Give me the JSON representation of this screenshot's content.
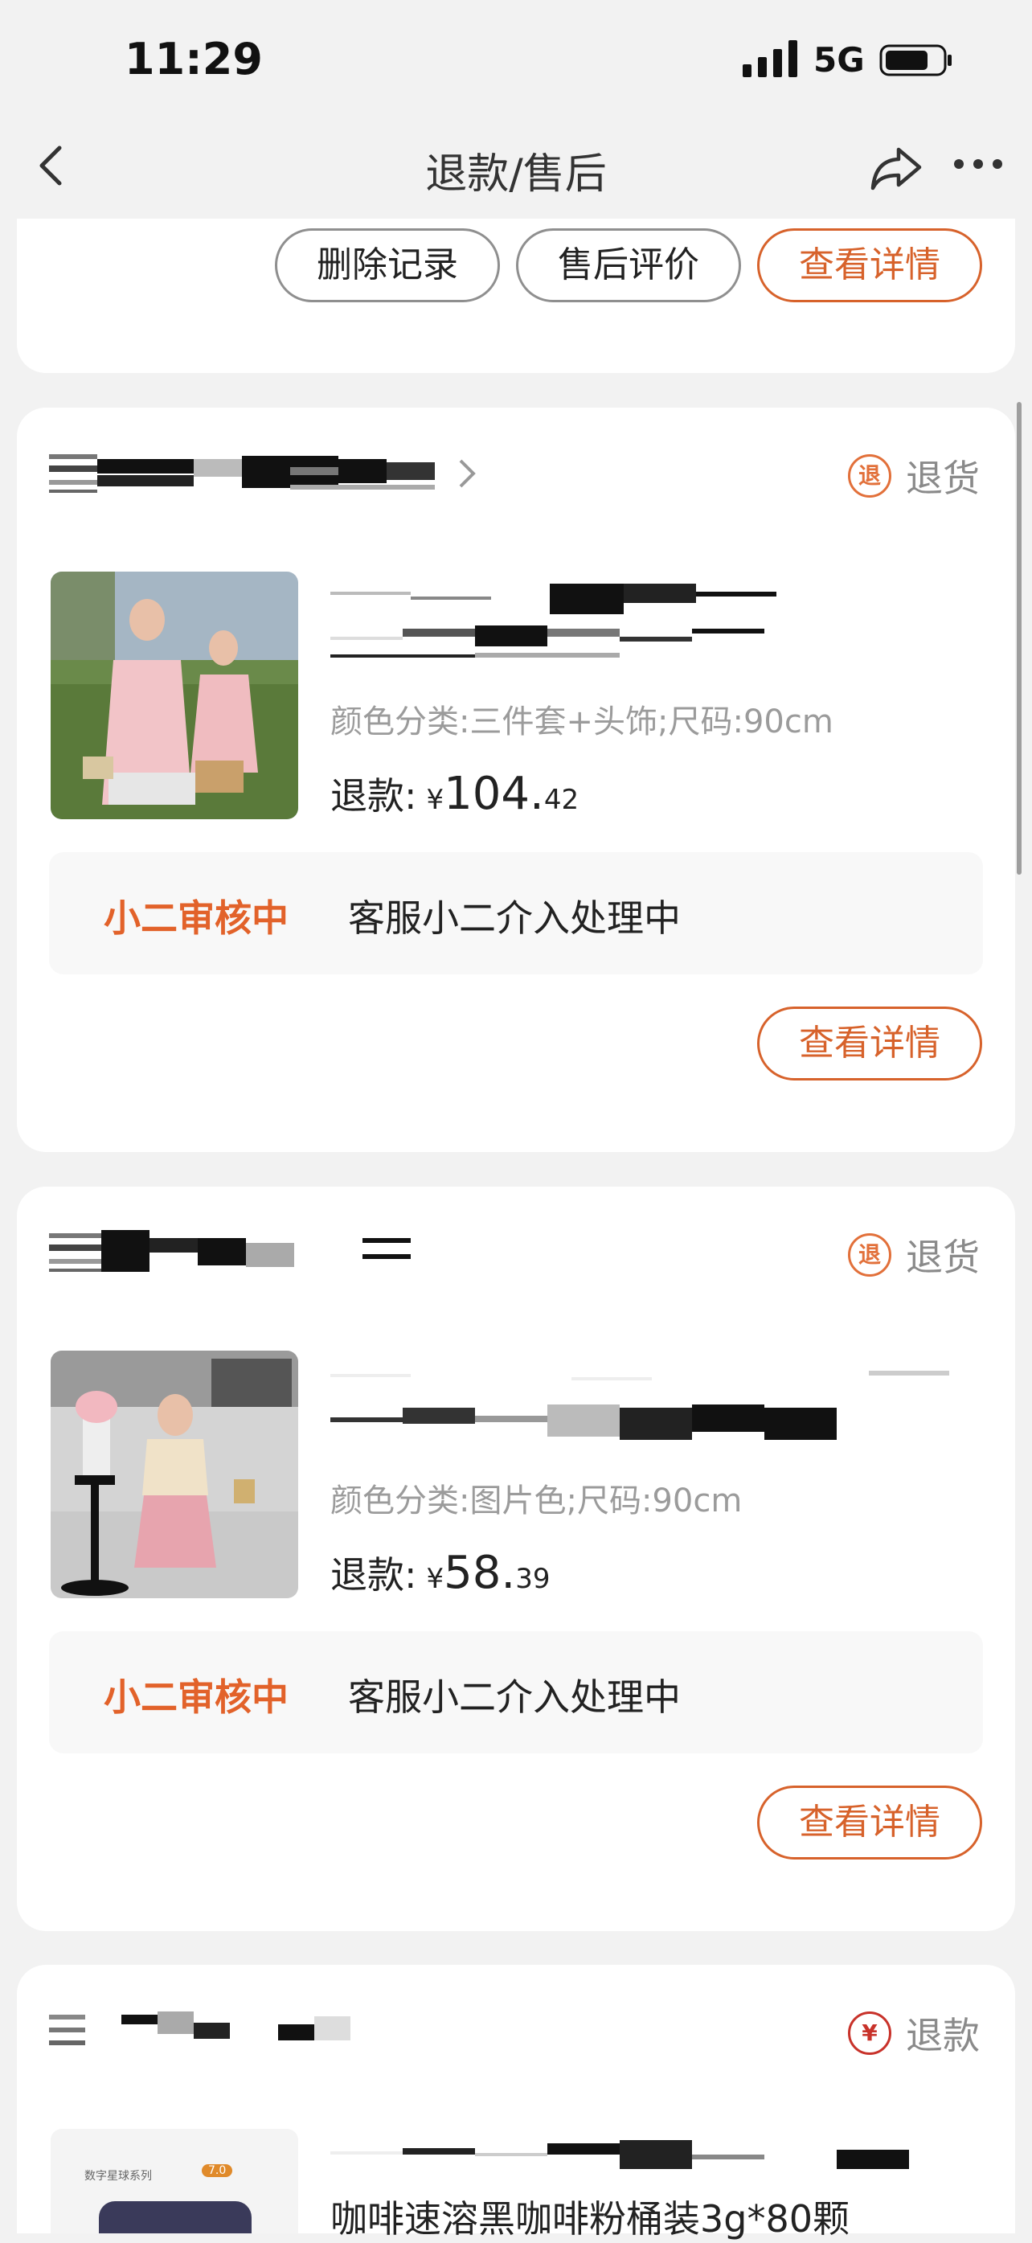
{
  "status_bar": {
    "time": "11:29",
    "network": "5G"
  },
  "nav": {
    "title": "退款/售后"
  },
  "top_card": {
    "buttons": [
      "删除记录",
      "售后评价",
      "查看详情"
    ]
  },
  "orders": [
    {
      "type_icon_text": "退",
      "type_label": "退货",
      "variant": "颜色分类:三件套+头饰;尺码:90cm",
      "refund_label": "退款:",
      "currency": "¥",
      "amount_int": "104.",
      "amount_dec": "42",
      "status": "小二审核中",
      "status_desc": "客服小二介入处理中",
      "detail_button": "查看详情"
    },
    {
      "type_icon_text": "退",
      "type_label": "退货",
      "variant": "颜色分类:图片色;尺码:90cm",
      "refund_label": "退款:",
      "currency": "¥",
      "amount_int": "58.",
      "amount_dec": "39",
      "status": "小二审核中",
      "status_desc": "客服小二介入处理中",
      "detail_button": "查看详情"
    },
    {
      "type_icon_text": "¥",
      "type_label": "退款",
      "product_title": "咖啡速溶黑咖啡粉桶装3g*80颗",
      "package_label": "数字星球系列",
      "package_badge": "7.0"
    }
  ],
  "colors": {
    "accent": "#e2622a",
    "page_bg": "#f2f2f2",
    "card_bg": "#ffffff"
  }
}
